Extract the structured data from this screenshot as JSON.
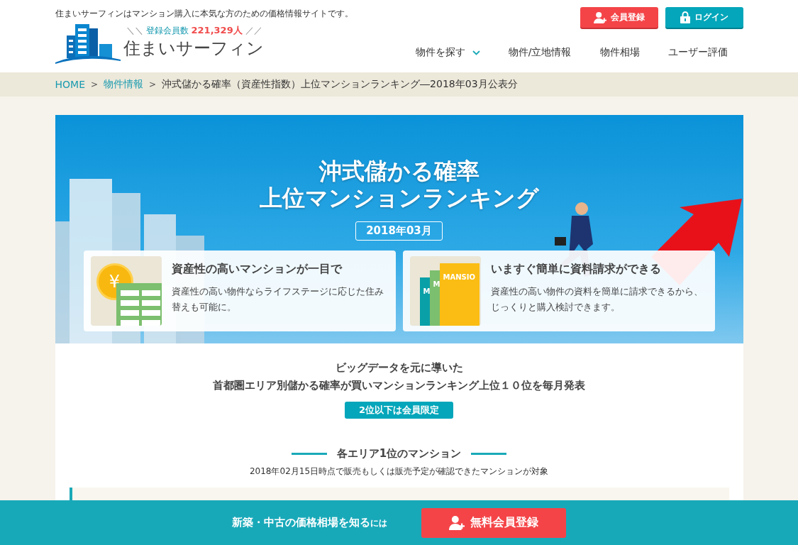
{
  "header": {
    "tagline": "住まいサーフィンはマンション購入に本気な方のための価格情報サイトです。",
    "slashes": [
      "＼＼",
      "／／"
    ],
    "member_count_label": "登録会員数",
    "member_count": "221,329人",
    "logo_text": "住まいサーフィン",
    "buttons": [
      {
        "kind": "register",
        "label": "会員登録"
      },
      {
        "kind": "login",
        "label": "ログイン"
      }
    ],
    "nav": [
      {
        "label": "物件を探す",
        "dropdown": true
      },
      {
        "label": "物件/立地情報",
        "dropdown": false
      },
      {
        "label": "物件相場",
        "dropdown": false
      },
      {
        "label": "ユーザー評価",
        "dropdown": false
      }
    ]
  },
  "breadcrumb_separator": ">",
  "breadcrumb": [
    {
      "label": "HOME",
      "link": true
    },
    {
      "label": "物件情報",
      "link": true
    },
    {
      "label": "沖式儲かる確率（資産性指数）上位マンションランキング―2018年03月公表分",
      "link": false
    }
  ],
  "hero": {
    "title_lines": [
      "沖式儲かる確率",
      "上位マンションランキング"
    ],
    "date": "2018年03月",
    "cards": [
      {
        "kind": "coin",
        "title": "資産性の高いマンションが一目で",
        "text": "資産性の高い物件ならライフステージに応じた住み替えも可能に。",
        "icon_text": "¥"
      },
      {
        "kind": "documents",
        "title": "いますぐ簡単に資料請求ができる",
        "text": "資産性の高い物件の資料を簡単に請求できるから、じっくりと購入検討できます。",
        "icon_texts": [
          "M",
          "M",
          "MANSIO"
        ]
      }
    ]
  },
  "intro": {
    "lines": [
      "ビッグデータを元に導いた",
      "首都圏エリア別儲かる確率が買いマンションランキング上位１０位を毎月発表"
    ],
    "badge": "2位以下は会員限定"
  },
  "section": {
    "title": "各エリア1位のマンション",
    "note": "2018年02月15日時点で販売もしくは販売予定が確認できたマンションが対象"
  },
  "footer_bar": {
    "text": "新築・中古の価格相場を知る",
    "suffix": "には",
    "button": "無料会員登録"
  }
}
